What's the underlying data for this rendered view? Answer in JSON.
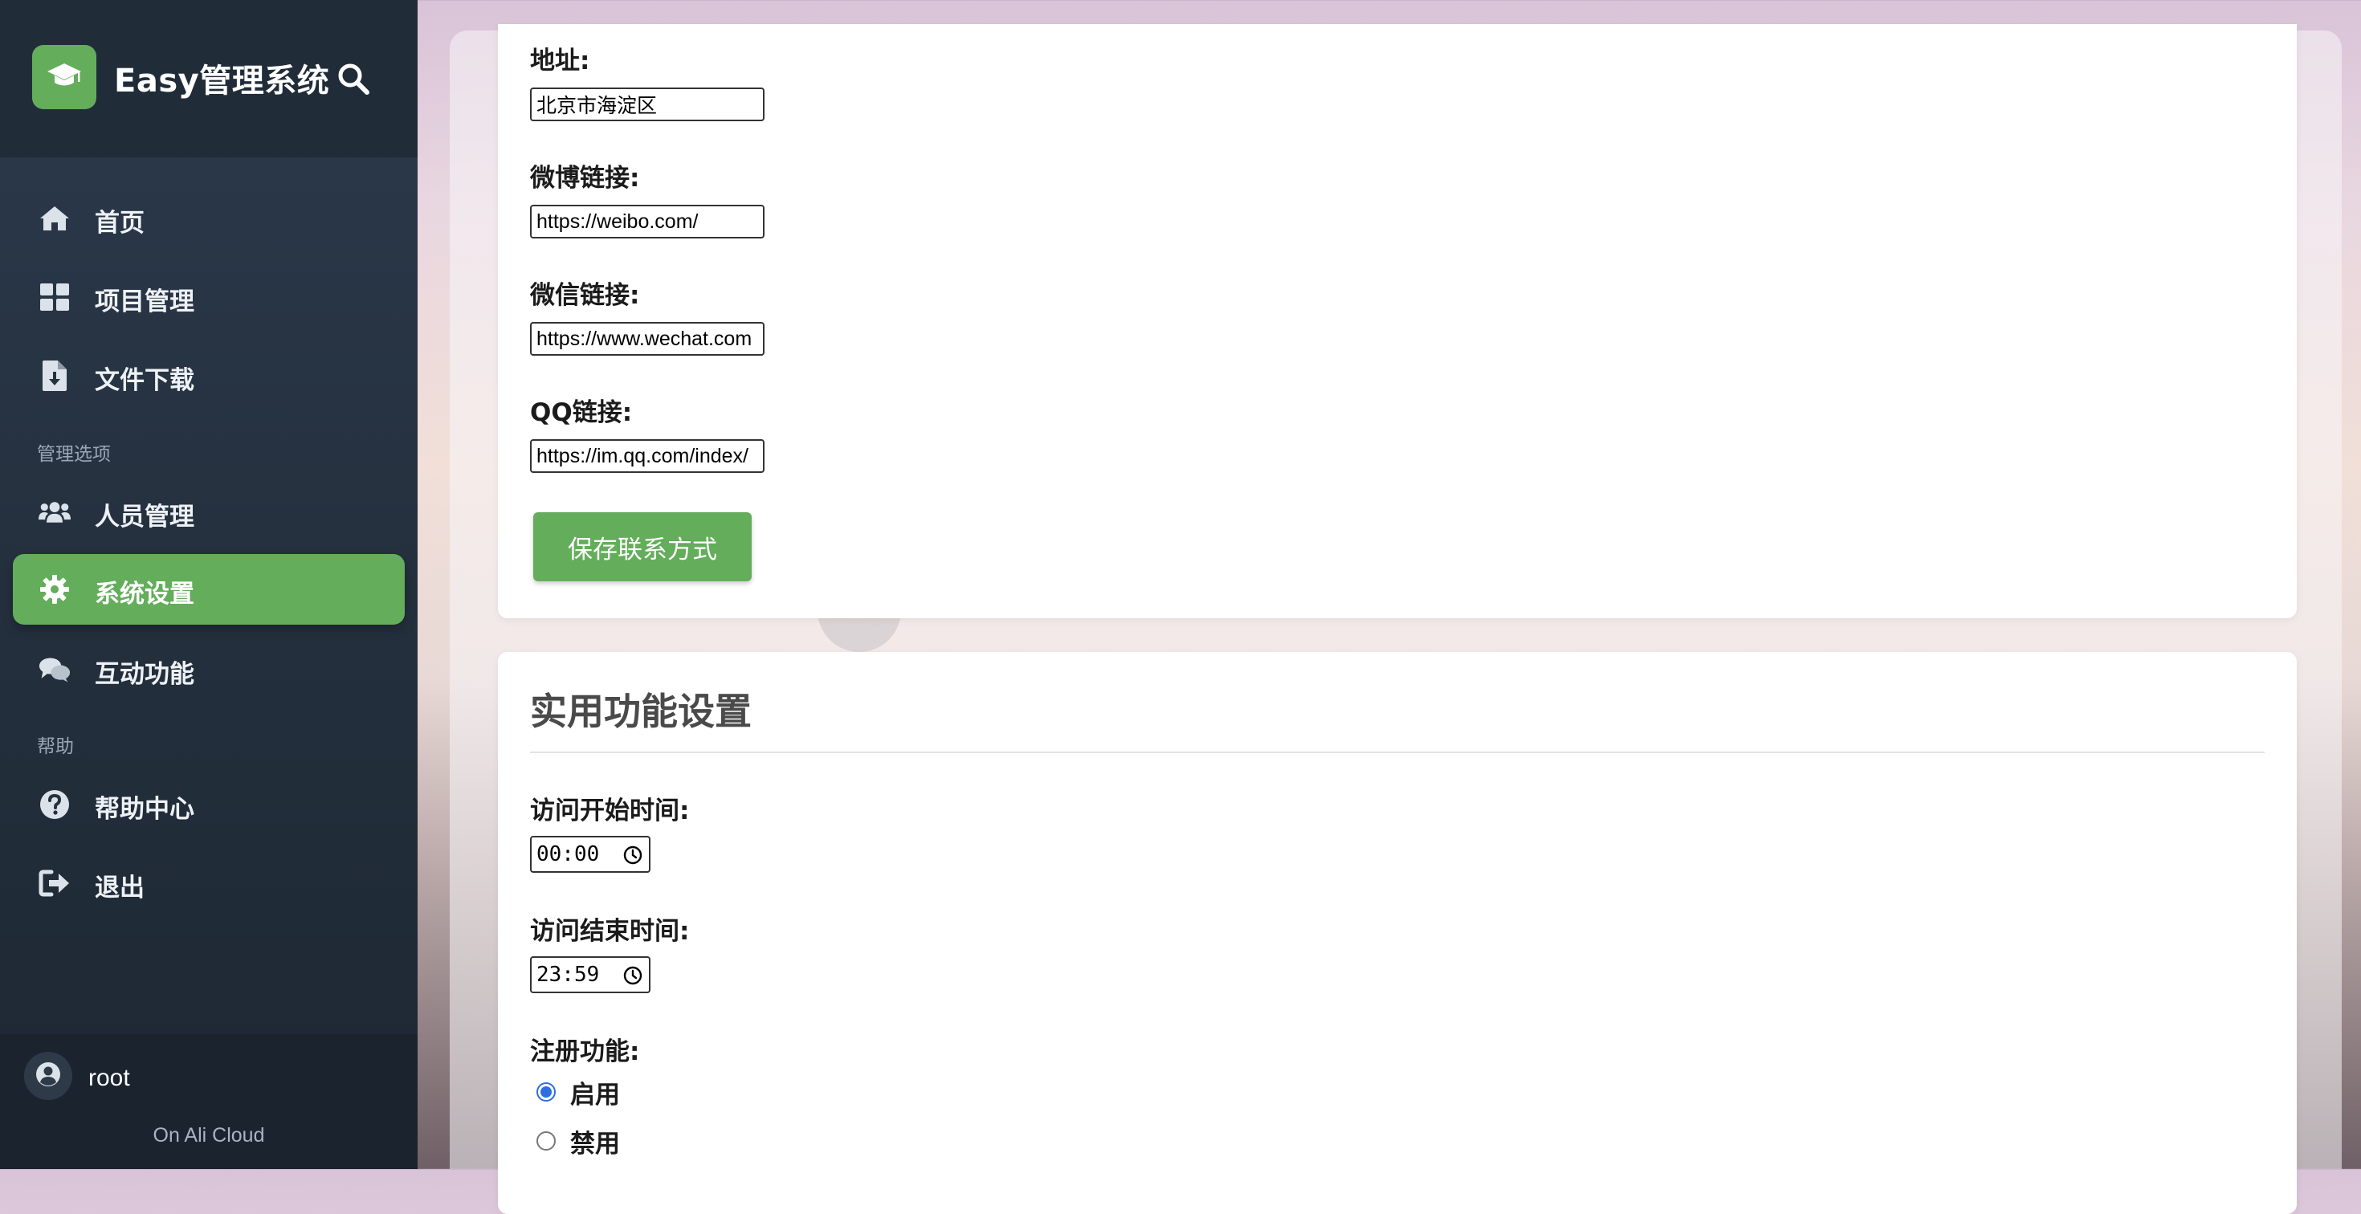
{
  "brand": {
    "title": "Easy管理系统"
  },
  "sidebar": {
    "items": [
      {
        "label": "首页",
        "icon": "home-icon"
      },
      {
        "label": "项目管理",
        "icon": "grid-icon"
      },
      {
        "label": "文件下载",
        "icon": "file-download-icon"
      }
    ],
    "section_manage": "管理选项",
    "manage_items": [
      {
        "label": "人员管理",
        "icon": "users-icon"
      },
      {
        "label": "系统设置",
        "icon": "gear-icon",
        "active": true
      },
      {
        "label": "互动功能",
        "icon": "comments-icon"
      }
    ],
    "section_help": "帮助",
    "help_items": [
      {
        "label": "帮助中心",
        "icon": "question-icon"
      },
      {
        "label": "退出",
        "icon": "sign-out-icon"
      }
    ]
  },
  "user": {
    "name": "root",
    "location": "On Ali Cloud"
  },
  "contact": {
    "address_label": "地址:",
    "address_value": "北京市海淀区",
    "weibo_label": "微博链接:",
    "weibo_value": "https://weibo.com/",
    "wechat_label": "微信链接:",
    "wechat_value": "https://www.wechat.com",
    "qq_label": "QQ链接:",
    "qq_value": "https://im.qq.com/index/",
    "save_label": "保存联系方式"
  },
  "utility": {
    "title": "实用功能设置",
    "start_label": "访问开始时间:",
    "start_value": "00:00",
    "end_label": "访问结束时间:",
    "end_value": "23:59",
    "register_label": "注册功能:",
    "enable_label": "启用",
    "disable_label": "禁用",
    "register_selected": "启用"
  },
  "colors": {
    "accent": "#63ad5b",
    "sidebar_bg": "#25313f",
    "radio_blue": "#2c6ee0"
  }
}
